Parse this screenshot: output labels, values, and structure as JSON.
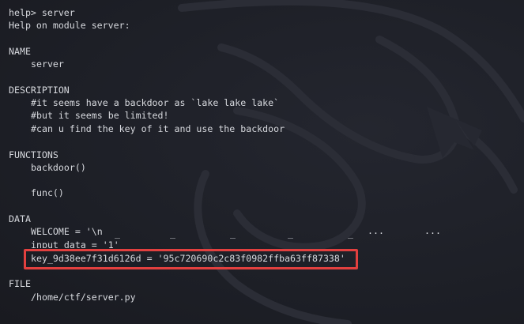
{
  "terminal": {
    "lines": [
      "help> server",
      "Help on module server:",
      "NAME",
      "server",
      "DESCRIPTION",
      "#it seems have a backdoor as `lake lake lake`",
      "#but it seems be limited!",
      "#can u find the key of it and use the backdoor",
      "FUNCTIONS",
      "backdoor()",
      "func()",
      "DATA",
      "WELCOME = '\\n",
      "input_data = '1'",
      "key_9d38ee7f31d6126d = '95c720690c2c83f0982ffba63ff87338'",
      "FILE",
      "/home/ctf/server.py"
    ],
    "welcome_art": [
      "_",
      "_",
      "_",
      "_",
      "_",
      "...",
      "..."
    ]
  },
  "colors": {
    "background": "#1f2129",
    "text": "#d7d9de",
    "highlight_border": "#e2403f"
  },
  "icons": {
    "background_logo": "kali-dragon-watermark"
  }
}
